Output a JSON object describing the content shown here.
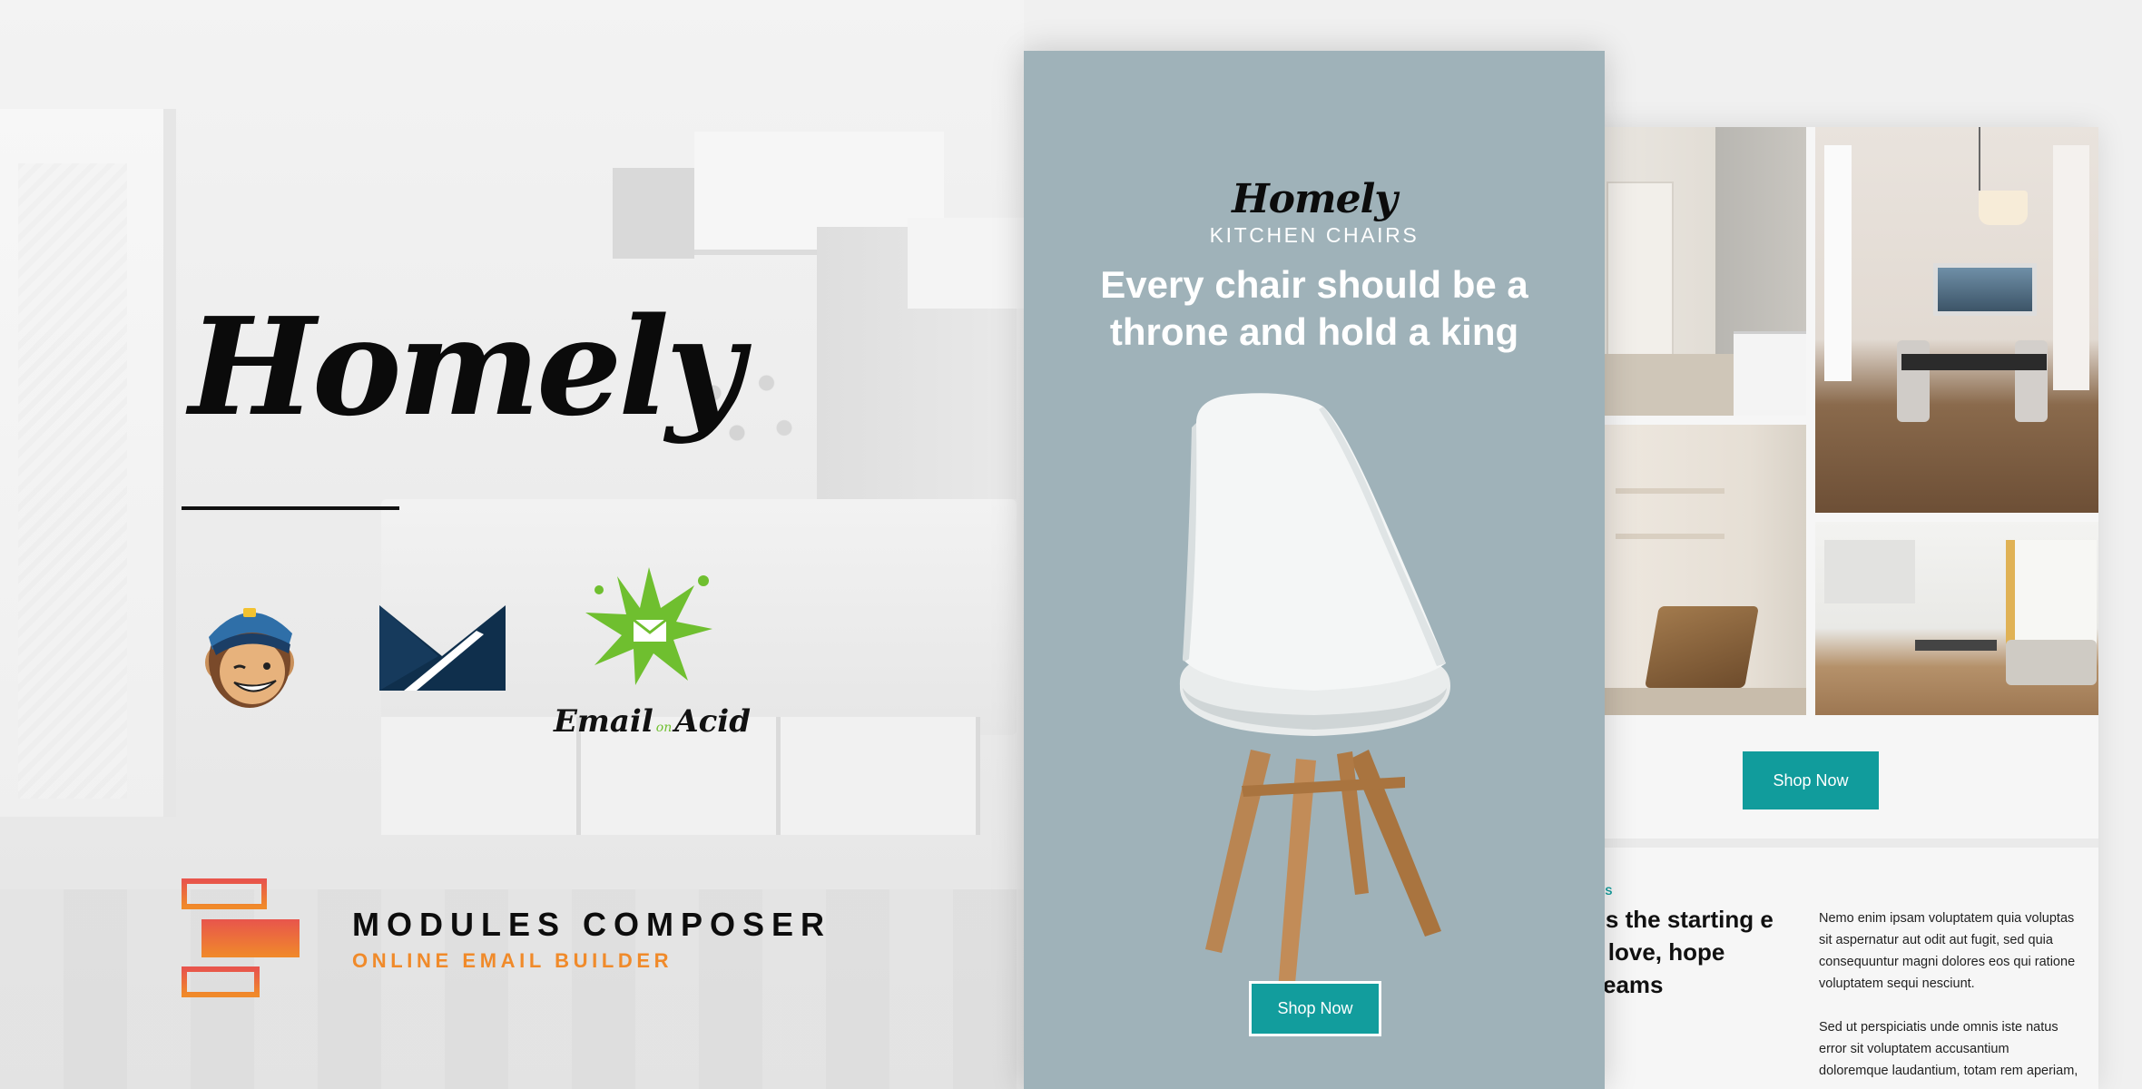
{
  "branding": {
    "name": "Homely"
  },
  "logos": {
    "email_on_acid": {
      "main": "Email",
      "on": "on",
      "end": "Acid"
    }
  },
  "modules_composer": {
    "title": "MODULES COMPOSER",
    "subtitle": "ONLINE EMAIL BUILDER"
  },
  "email_front": {
    "brand": "Homely",
    "eyebrow": "KITCHEN CHAIRS",
    "headline": "Every chair should be a throne and hold a king",
    "button_label": "Shop Now"
  },
  "email_back": {
    "button_label": "Shop Now",
    "eyebrow": "ENDS",
    "headline": "e is the starting e of love, hope dreams",
    "body_paragraphs": [
      "Nemo enim ipsam voluptatem quia voluptas sit aspernatur aut odit aut fugit, sed quia consequuntur magni dolores eos qui ratione voluptatem sequi nesciunt.",
      "Sed ut perspiciatis unde omnis iste natus error sit voluptatem accusantium doloremque laudantium, totam rem aperiam,"
    ]
  },
  "colors": {
    "accent_teal": "#129d9d",
    "front_card_bg": "#9fb2b9",
    "orange": "#f08a2a",
    "coral": "#e8554c"
  },
  "icons": [
    "mailchimp-logo-icon",
    "postmark-logo-icon",
    "email-on-acid-logo-icon",
    "modules-composer-icon"
  ]
}
